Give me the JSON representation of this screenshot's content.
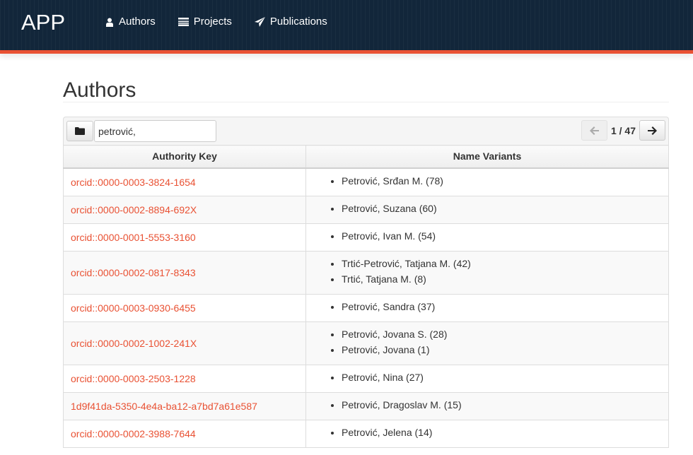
{
  "navbar": {
    "brand": "APP",
    "items": [
      {
        "label": "Authors",
        "icon": "user-icon"
      },
      {
        "label": "Projects",
        "icon": "list-icon"
      },
      {
        "label": "Publications",
        "icon": "paper-plane-icon"
      }
    ],
    "accent_color": "#e95133",
    "background_color": "#12263a"
  },
  "page": {
    "title": "Authors"
  },
  "toolbar": {
    "folder_icon": "folder-icon",
    "search_value": "petrović,",
    "pager": {
      "prev_icon": "arrow-left-icon",
      "next_icon": "arrow-right-icon",
      "text": "1 / 47",
      "current": 1,
      "total": 47
    }
  },
  "table": {
    "columns": [
      "Authority Key",
      "Name Variants"
    ],
    "rows": [
      {
        "key": "orcid::0000-0003-3824-1654",
        "variants": [
          "Petrović, Srđan M. (78)"
        ]
      },
      {
        "key": "orcid::0000-0002-8894-692X",
        "variants": [
          "Petrović, Suzana (60)"
        ]
      },
      {
        "key": "orcid::0000-0001-5553-3160",
        "variants": [
          "Petrović, Ivan M. (54)"
        ]
      },
      {
        "key": "orcid::0000-0002-0817-8343",
        "variants": [
          "Trtić-Petrović, Tatjana M. (42)",
          "Trtić, Tatjana M. (8)"
        ]
      },
      {
        "key": "orcid::0000-0003-0930-6455",
        "variants": [
          "Petrović, Sandra (37)"
        ]
      },
      {
        "key": "orcid::0000-0002-1002-241X",
        "variants": [
          "Petrović, Jovana S. (28)",
          "Petrović, Jovana (1)"
        ]
      },
      {
        "key": "orcid::0000-0003-2503-1228",
        "variants": [
          "Petrović, Nina (27)"
        ]
      },
      {
        "key": "1d9f41da-5350-4e4a-ba12-a7bd7a61e587",
        "variants": [
          "Petrović, Dragoslav M. (15)"
        ]
      },
      {
        "key": "orcid::0000-0002-3988-7644",
        "variants": [
          "Petrović, Jelena (14)"
        ]
      }
    ]
  }
}
